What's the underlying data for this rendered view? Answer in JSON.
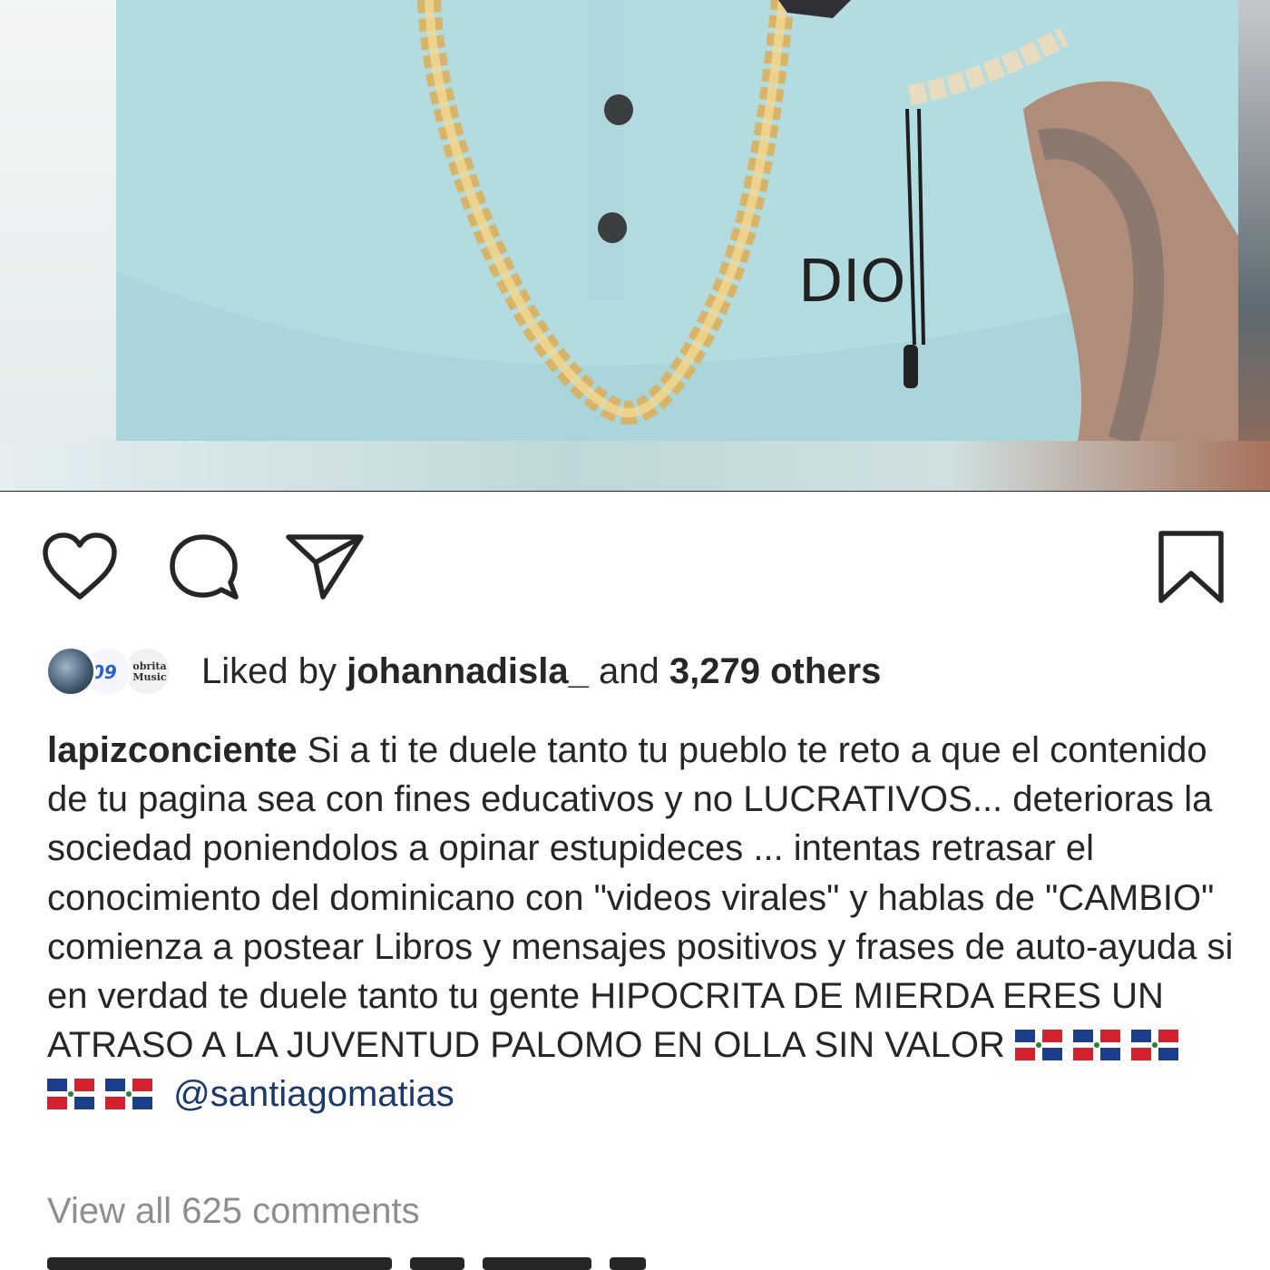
{
  "post": {
    "liked_by_prefix": "Liked by",
    "liked_by_user": "johannadisla_",
    "liked_by_and": "and",
    "liked_by_others": "3,279 others",
    "avatar_2_text": "09",
    "avatar_3_text": "obrita Music",
    "caption_user": "lapizconciente",
    "caption_text": "Si a ti te duele tanto tu pueblo te reto a que el contenido de tu pagina sea con fines educativos y no LUCRATIVOS... deterioras la sociedad poniendolos a opinar estupideces ... intentas retrasar el conocimiento del dominicano con \"videos virales\" y hablas de \"CAMBIO\" comienza a postear Libros y mensajes positivos y frases de auto-ayuda si en verdad te duele tanto tu gente HIPOCRITA DE MIERDA ERES UN ATRASO A LA JUVENTUD PALOMO EN OLLA SIN VALOR",
    "caption_mention": "@santiagomatias",
    "flag_count": 5,
    "view_comments": "View all 625 comments"
  },
  "photo": {
    "shirt_logo": "DIO"
  },
  "icons": {
    "like": "heart-icon",
    "comment": "comment-bubble-icon",
    "share": "paper-plane-icon",
    "save": "bookmark-icon",
    "flag": "dominican-flag-icon"
  },
  "colors": {
    "text": "#262626",
    "muted": "#8e8e8e",
    "mention": "#1b3a6b",
    "shirt": "#aed8dd"
  }
}
